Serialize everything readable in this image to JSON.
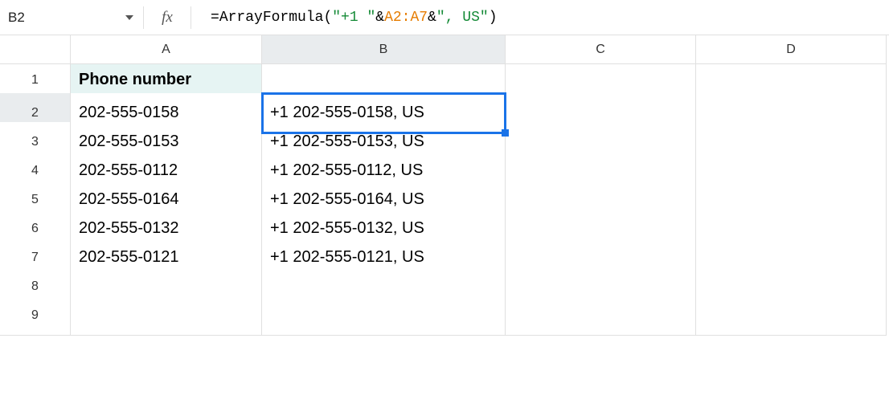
{
  "name_box": "B2",
  "fx_label": "fx",
  "formula": {
    "equals": "=",
    "fn": "ArrayFormula",
    "open": "(",
    "str1": "\"+1 \"",
    "amp1": "&",
    "range": "A2:A7",
    "amp2": "&",
    "str2": "\", US\"",
    "close": ")"
  },
  "columns": [
    "A",
    "B",
    "C",
    "D"
  ],
  "rows": [
    "1",
    "2",
    "3",
    "4",
    "5",
    "6",
    "7",
    "8",
    "9"
  ],
  "header_label": "Phone number",
  "selected_cell": "B2",
  "data_a": [
    "202-555-0158",
    "202-555-0153",
    "202-555-0112",
    "202-555-0164",
    "202-555-0132",
    "202-555-0121"
  ],
  "data_b": [
    "+1 202-555-0158, US",
    "+1 202-555-0153, US",
    "+1 202-555-0112, US",
    "+1 202-555-0164, US",
    "+1 202-555-0132, US",
    "+1 202-555-0121, US"
  ]
}
